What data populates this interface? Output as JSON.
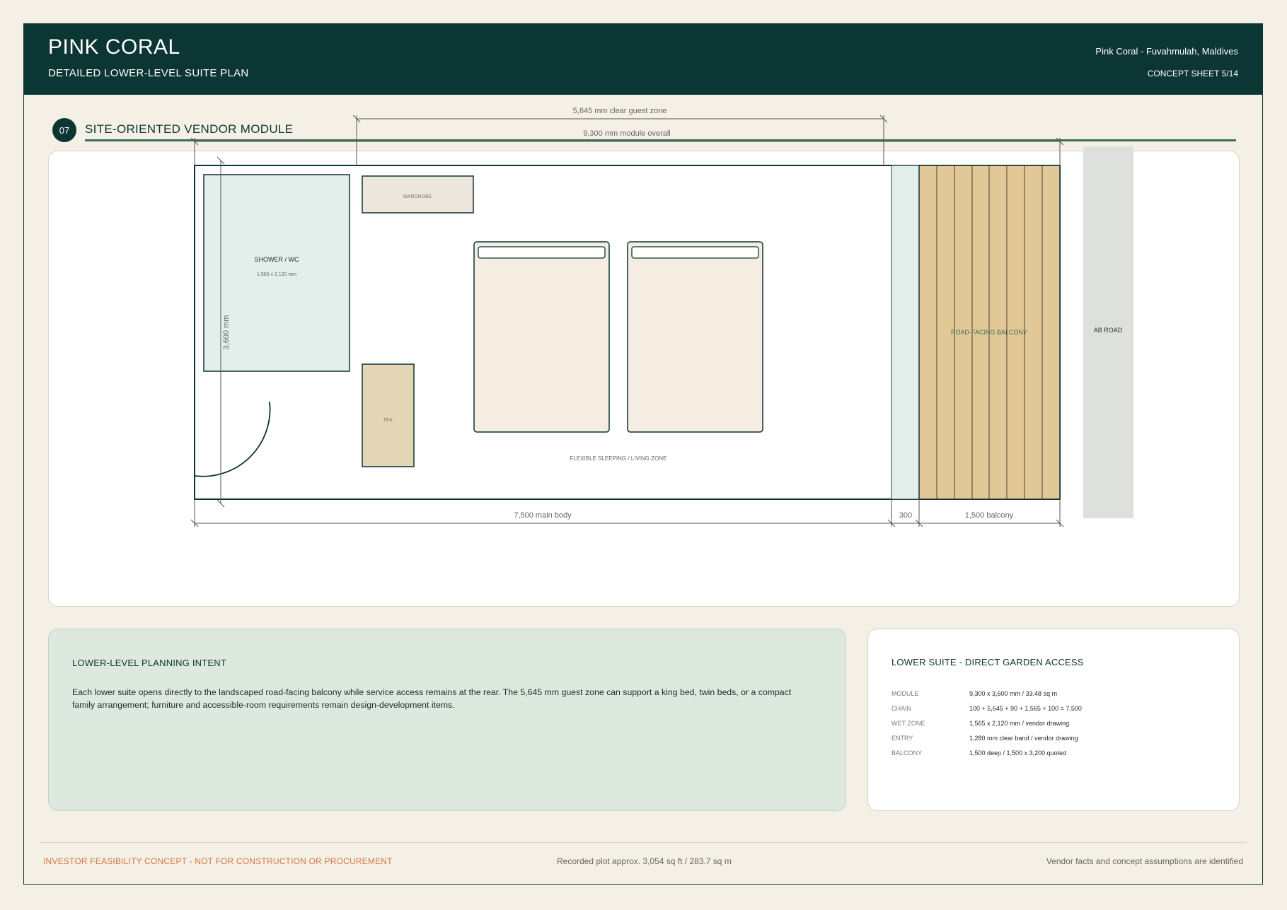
{
  "header": {
    "title": "PINK CORAL",
    "subtitle": "DETAILED LOWER-LEVEL SUITE PLAN",
    "location": "Pink Coral - Fuvahmulah, Maldives",
    "sheet": "CONCEPT SHEET 5/14"
  },
  "section": {
    "number": "07",
    "title": "SITE-ORIENTED VENDOR MODULE"
  },
  "plan": {
    "dim_guest_zone": "5,645 mm clear guest zone",
    "dim_overall": "9,300 mm module overall",
    "dim_height": "3,600 mm",
    "dim_main_body": "7,500 main body",
    "dim_gap": "300",
    "dim_balcony": "1,500 balcony",
    "shower_label": "SHOWER / WC",
    "shower_size": "1,565 x 2,120 mm",
    "wardrobe_label": "WARDROBE",
    "tea_label": "TEA",
    "zone_label": "FLEXIBLE SLEEPING / LIVING ZONE",
    "balcony_label": "ROAD-FACING BALCONY",
    "road_label": "AB ROAD"
  },
  "notes": {
    "title": "LOWER-LEVEL PLANNING INTENT",
    "body": "Each lower suite opens directly to the landscaped road-facing balcony while service access remains at the rear. The 5,645 mm guest zone can support a king bed, twin beds, or a compact family arrangement; furniture and accessible-room requirements remain design-development items."
  },
  "specs": {
    "title": "LOWER SUITE - DIRECT GARDEN ACCESS",
    "rows": [
      {
        "key": "MODULE",
        "value": "9,300 x 3,600 mm / 33.48 sq m"
      },
      {
        "key": "CHAIN",
        "value": "100 + 5,645 + 90 + 1,565 + 100 = 7,500"
      },
      {
        "key": "WET ZONE",
        "value": "1,565 x 2,120 mm / vendor drawing"
      },
      {
        "key": "ENTRY",
        "value": "1,280 mm clear band / vendor drawing"
      },
      {
        "key": "BALCONY",
        "value": "1,500 deep / 1,500 x 3,200 quoted"
      }
    ]
  },
  "footer": {
    "left": "INVESTOR FEASIBILITY CONCEPT - NOT FOR CONSTRUCTION OR PROCUREMENT",
    "middle": "Recorded plot approx. 3,054 sq ft / 283.7 sq m",
    "right": "Vendor facts and concept assumptions are identified"
  },
  "colors": {
    "header": "#0c3633",
    "accent_line": "#3a6e58",
    "wet_zone": "#e2efeb",
    "bed": "#f5ece2",
    "tea": "#e6d6b8",
    "balcony": "#e2c896",
    "road": "#dde0dc",
    "footer_warning": "#d2774a"
  }
}
